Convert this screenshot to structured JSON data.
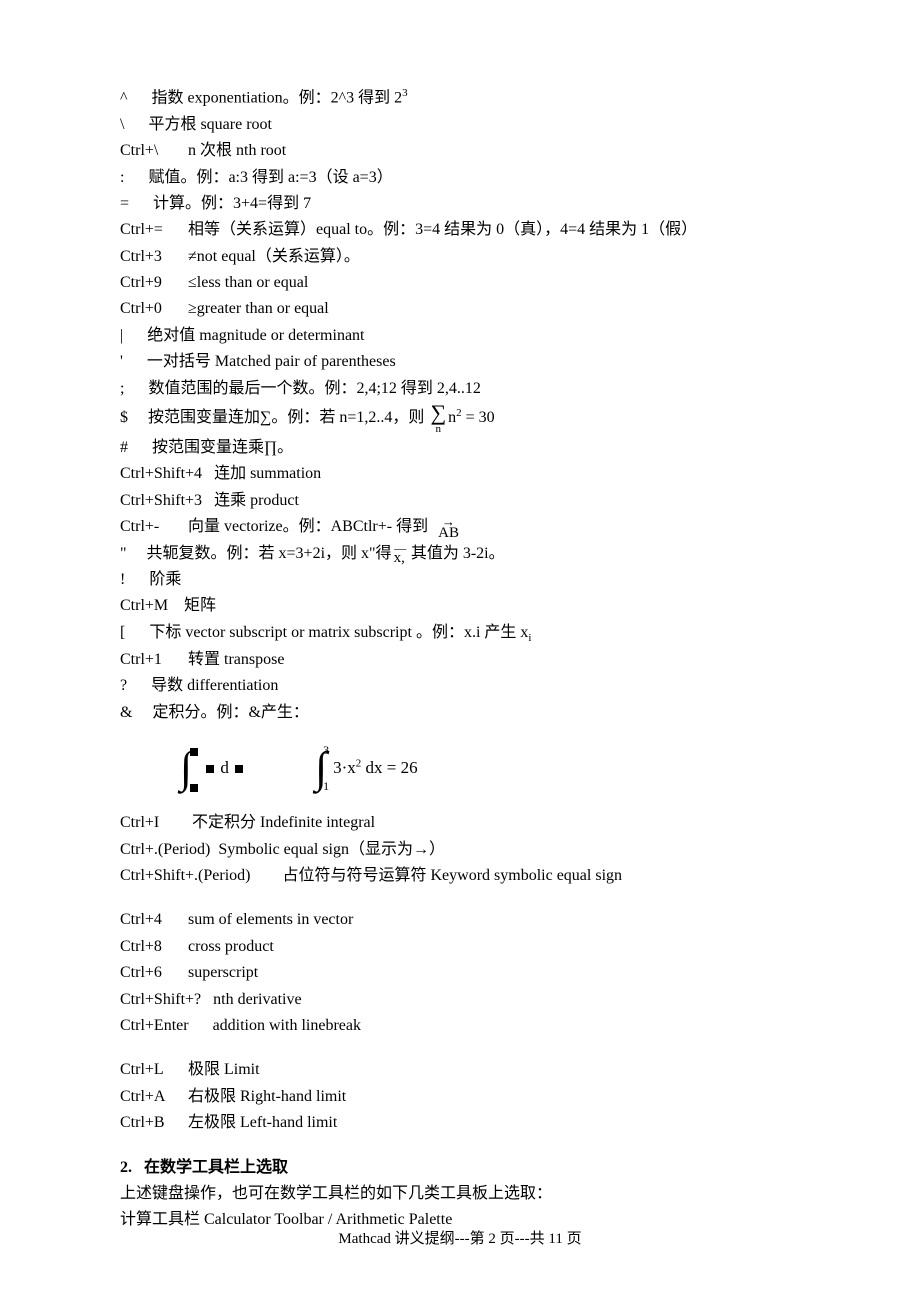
{
  "l1_pre": "^      指数 exponentiation。例：2^3 得到 2",
  "l1_sup": "3",
  "l2": "\\      平方根 square root",
  "l3_k": "Ctrl+\\",
  "l3_t": "n 次根 nth root",
  "l4": ":      赋值。例：a:3 得到 a:=3（设 a=3）",
  "l5": "=      计算。例：3+4=得到 7",
  "l6_k": "Ctrl+=",
  "l6_t": "相等（关系运算）equal to。例：3=4 结果为 0（真），4=4 结果为 1（假）",
  "l7_k": "Ctrl+3",
  "l7_t": "≠not equal（关系运算）。",
  "l8_k": "Ctrl+9",
  "l8_t": "≤less than or equal",
  "l9_k": "Ctrl+0",
  "l9_t": "≥greater than or equal",
  "l10": "|      绝对值 magnitude or determinant",
  "l11": "'      一对括号 Matched pair of parentheses",
  "l12": ";      数值范围的最后一个数。例：2,4;12 得到 2,4..12",
  "l13_pre": "$     按范围变量连加∑。例：若 n=1,2..4，则 ",
  "sigma_top": "2",
  "sigma_n": "n",
  "sigma_eq": " = 30",
  "l14": "#      按范围变量连乘∏。",
  "l15_k": "Ctrl+Shift+4",
  "l15_t": "连加 summation",
  "l16_k": "Ctrl+Shift+3",
  "l16_t": "连乘 product",
  "l17_k": "Ctrl+-",
  "l17_t": "向量 vectorize。例：ABCtlr+- 得到  ",
  "vec_arr": "→",
  "vec_ab": "AB",
  "l18_pre": "\"     共轭复数。例：若 x=3+2i，则 x\"得",
  "conj_bar": "—",
  "conj_x": "x,",
  "l18_post": " 其值为 3-2i。",
  "l19": "!      阶乘",
  "l20_k": "Ctrl+M",
  "l20_t": "矩阵",
  "l21_pre": "[      下标 vector subscript or matrix subscript 。例：x.i 产生 x",
  "l21_sub": "i",
  "l22_k": "Ctrl+1",
  "l22_t": "转置 transpose",
  "l23": "?      导数 differentiation",
  "l24": "&     定积分。例：&产生：",
  "int2_upper": "3",
  "int2_lower": "1",
  "int2_body": "3·x",
  "int2_sup": "2",
  "int2_dx": " dx = 26",
  "l25_k": "Ctrl+I",
  "l25_t": "不定积分 Indefinite integral",
  "l26": "Ctrl+.(Period)  Symbolic equal sign（显示为→）",
  "l27": "Ctrl+Shift+.(Period)        占位符与符号运算符 Keyword symbolic equal sign",
  "l28_k": "Ctrl+4",
  "l28_t": "sum of elements in vector",
  "l29_k": "Ctrl+8",
  "l29_t": "cross product",
  "l30_k": "Ctrl+6",
  "l30_t": "superscript",
  "l31_k": "Ctrl+Shift+?",
  "l31_t": "nth derivative",
  "l32_k": "Ctrl+Enter",
  "l32_t": "addition with linebreak",
  "l33_k": "Ctrl+L",
  "l33_t": "极限 Limit",
  "l34_k": "Ctrl+A",
  "l34_t": "右极限 Right-hand limit",
  "l35_k": "Ctrl+B",
  "l35_t": "左极限 Left-hand limit",
  "sec2_num": "2.",
  "sec2_title": "在数学工具栏上选取",
  "sec2_p1": "上述键盘操作，也可在数学工具栏的如下几类工具板上选取：",
  "sec2_p2": "计算工具栏 Calculator Toolbar / Arithmetic Palette",
  "footer": "Mathcad 讲义提纲---第 2 页---共 11 页"
}
